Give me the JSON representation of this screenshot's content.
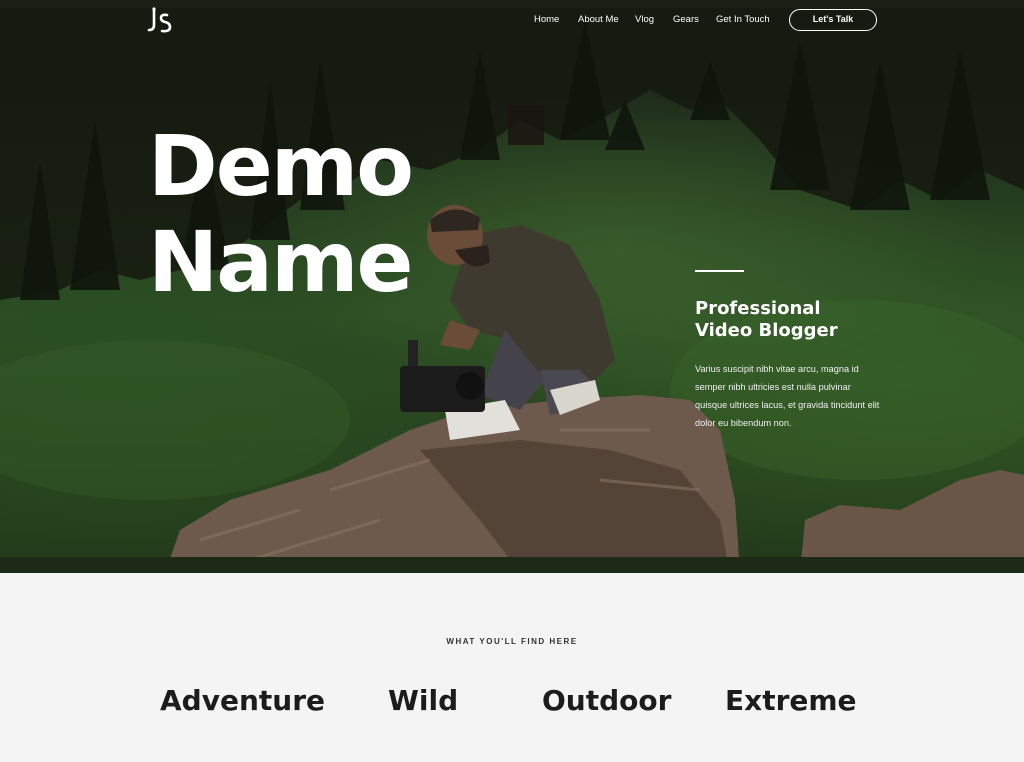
{
  "brand": {
    "logo_text": "JS"
  },
  "nav": {
    "items": [
      "Home",
      "About Me",
      "Vlog",
      "Gears",
      "Get In Touch"
    ],
    "cta_label": "Let's Talk"
  },
  "hero": {
    "title_line1": "Demo",
    "title_line2": "Name",
    "subtitle_line1": "Professional",
    "subtitle_line2": "Video Blogger",
    "description": "Varius suscipit nibh vitae arcu, magna id semper nibh ultricies est nulla pulvinar quisque ultrices lacus, et gravida tincidunt elit dolor eu bibendum non."
  },
  "section": {
    "label": "WHAT YOU'LL FIND HERE",
    "categories": [
      "Adventure",
      "Wild",
      "Outdoor",
      "Extreme"
    ]
  }
}
